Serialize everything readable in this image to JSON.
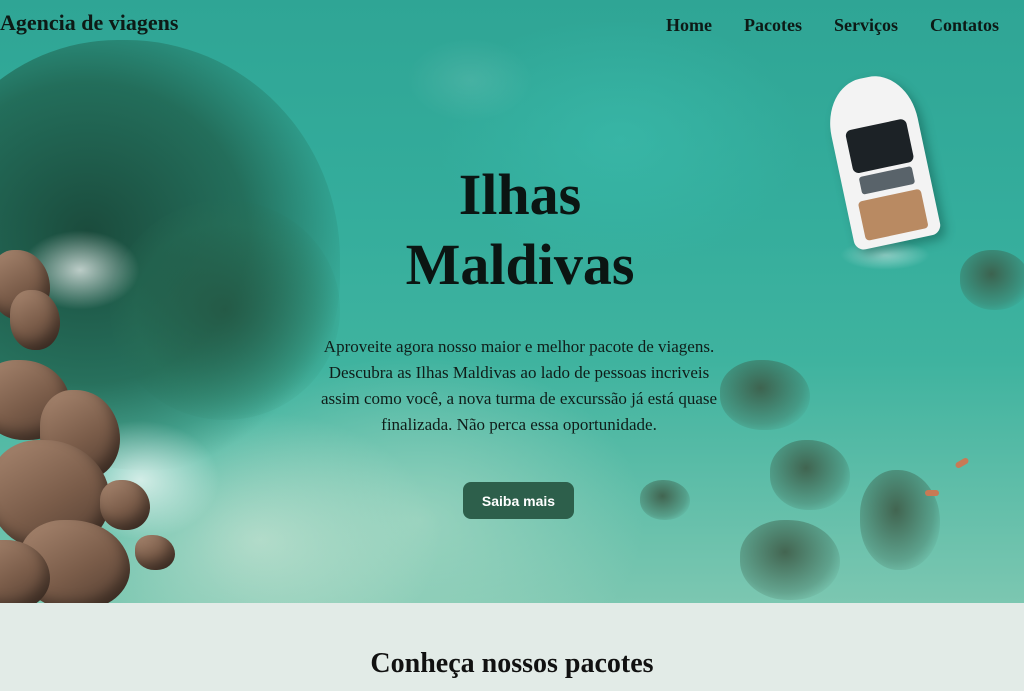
{
  "header": {
    "brand": "Agencia de viagens",
    "nav": [
      {
        "label": "Home"
      },
      {
        "label": "Pacotes"
      },
      {
        "label": "Serviços"
      },
      {
        "label": "Contatos"
      }
    ]
  },
  "hero": {
    "title_line1": "Ilhas",
    "title_line2": "Maldivas",
    "description": "Aproveite agora nosso maior e melhor pacote de viagens. Descubra as Ilhas Maldivas ao lado de pessoas incriveis assim como você, a nova turma de excurssão já está quase finalizada. Não perca essa oportunidade.",
    "cta_label": "Saiba mais"
  },
  "packages": {
    "title": "Conheça nossos pacotes"
  },
  "colors": {
    "accent": "#2d5f4b",
    "section_bg": "#e2ebe7"
  }
}
